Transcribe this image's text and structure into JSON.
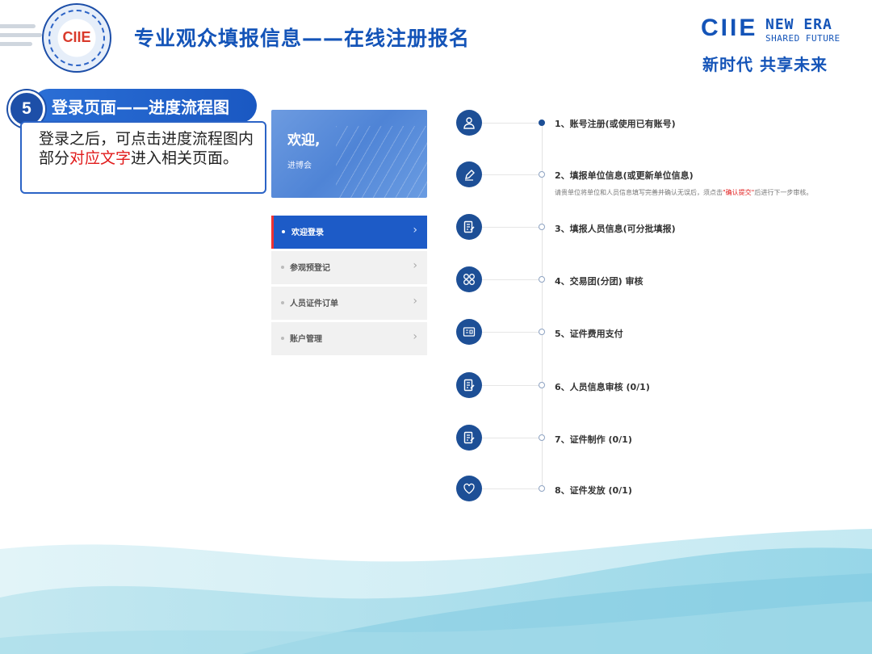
{
  "header": {
    "title": "专业观众填报信息——在线注册报名",
    "logo_text": "CIIE",
    "brand": "CIIE",
    "new_era": "NEW ERA",
    "shared_future": "SHARED FUTURE",
    "slogan": "新时代 共享未来"
  },
  "step": {
    "number": "5",
    "label": "登录页面——进度流程图",
    "note_part1": "登录之后，可点击进度流程图内部分",
    "note_highlight": "对应文字",
    "note_part2": "进入相关页面。"
  },
  "welcome": {
    "title": "欢迎,",
    "subtitle": "进博会"
  },
  "menu": [
    {
      "label": "欢迎登录",
      "chevron": "›",
      "active": true
    },
    {
      "label": "参观预登记",
      "chevron": "›",
      "active": false
    },
    {
      "label": "人员证件订单",
      "chevron": "›",
      "active": false
    },
    {
      "label": "账户管理",
      "chevron": "›",
      "active": false
    }
  ],
  "timeline": [
    {
      "label": "1、账号注册(或使用已有账号)",
      "icon": "user-icon",
      "done": true
    },
    {
      "label": "2、填报单位信息(或更新单位信息)",
      "icon": "pen-icon",
      "done": false,
      "desc_part1": "请贵单位将单位和人员信息填写完善并确认无误后，须点击",
      "desc_highlight": "\"确认提交\"",
      "desc_part2": "后进行下一步审核。"
    },
    {
      "label": "3、填报人员信息(可分批填报)",
      "icon": "document-edit-icon",
      "done": false
    },
    {
      "label": "4、交易团(分团) 审核",
      "icon": "grid-icon",
      "done": false
    },
    {
      "label": "5、证件费用支付",
      "icon": "payment-icon",
      "done": false
    },
    {
      "label": "6、人员信息审核 (0/1)",
      "icon": "document-edit-icon",
      "done": false
    },
    {
      "label": "7、证件制作 (0/1)",
      "icon": "document-edit-icon",
      "done": false
    },
    {
      "label": "8、证件发放 (0/1)",
      "icon": "heart-icon",
      "done": false
    }
  ],
  "colors": {
    "primary": "#1454b8",
    "timeline_circle": "#1d4f96",
    "highlight_red": "#e11b1b",
    "menu_active": "#1d5bc7"
  }
}
